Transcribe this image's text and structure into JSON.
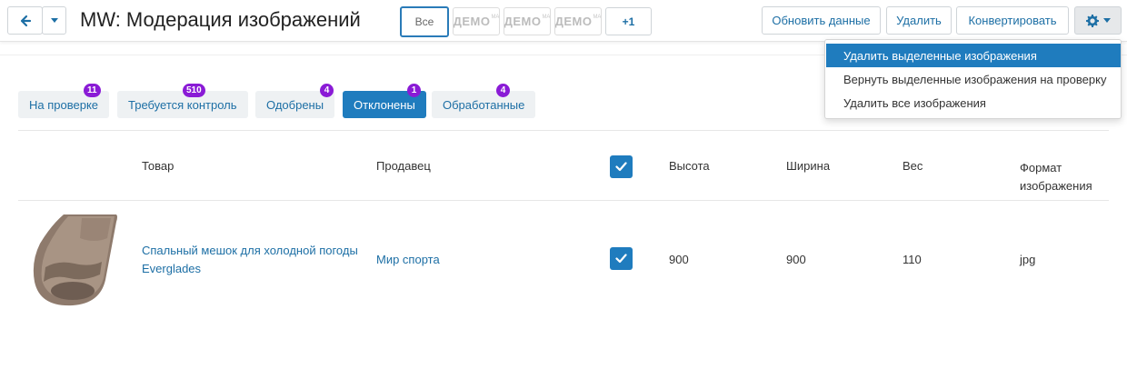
{
  "header": {
    "title": "MW: Модерация изображений",
    "thumbnails": {
      "all_label": "Все",
      "demo_word": "ДЕМО",
      "demo_sub": "МА",
      "more_label": "+1"
    },
    "actions": {
      "refresh_label": "Обновить данные",
      "delete_label": "Удалить",
      "convert_label": "Конвертировать"
    }
  },
  "dropdown": {
    "items": [
      {
        "label": "Удалить выделенные изображения"
      },
      {
        "label": "Вернуть выделенные изображения на проверку"
      },
      {
        "label": "Удалить все изображения"
      }
    ]
  },
  "tabs": [
    {
      "label": "На проверке",
      "badge": "11"
    },
    {
      "label": "Требуется контроль",
      "badge": "510"
    },
    {
      "label": "Одобрены",
      "badge": "4"
    },
    {
      "label": "Отклонены",
      "badge": "1",
      "active": true
    },
    {
      "label": "Обработанные",
      "badge": "4"
    }
  ],
  "table": {
    "headers": {
      "product": "Товар",
      "seller": "Продавец",
      "height": "Высота",
      "width": "Ширина",
      "weight": "Вес",
      "format_line1": "Формат",
      "format_line2": "изображения"
    },
    "rows": [
      {
        "product_line1": "Спальный мешок для холодной погоды",
        "product_line2": "Everglades",
        "seller": "Мир спорта",
        "height": "900",
        "width": "900",
        "weight": "110",
        "format": "jpg"
      }
    ]
  },
  "colors": {
    "accent": "#1f7cbe",
    "badge": "#8a1bd6",
    "link": "#1d6fa5"
  }
}
